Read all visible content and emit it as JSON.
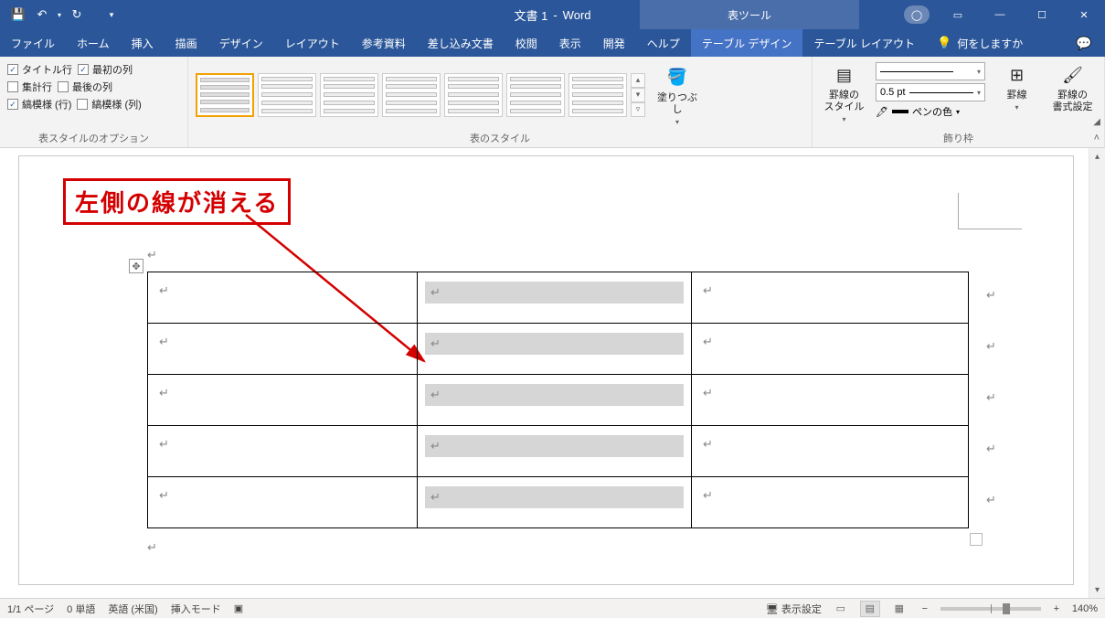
{
  "titlebar": {
    "doc_title": "文書 1",
    "app_name": "Word",
    "contextual_label": "表ツール"
  },
  "tabs": {
    "file": "ファイル",
    "home": "ホーム",
    "insert": "挿入",
    "draw": "描画",
    "design": "デザイン",
    "layout": "レイアウト",
    "references": "参考資料",
    "mailings": "差し込み文書",
    "review": "校閲",
    "view": "表示",
    "developer": "開発",
    "help": "ヘルプ",
    "table_design": "テーブル デザイン",
    "table_layout": "テーブル レイアウト",
    "tellme": "何をしますか"
  },
  "ribbon": {
    "group_style_options": "表スタイルのオプション",
    "group_table_styles": "表のスタイル",
    "group_borders": "飾り枠",
    "opt_header_row": "タイトル行",
    "opt_first_col": "最初の列",
    "opt_total_row": "集計行",
    "opt_last_col": "最後の列",
    "opt_banded_rows": "縞模様 (行)",
    "opt_banded_cols": "縞模様 (列)",
    "shading": "塗りつぶし",
    "border_styles": "罫線の\nスタイル",
    "border_weight": "0.5 pt",
    "pen_color": "ペンの色",
    "borders": "罫線",
    "border_painter": "罫線の\n書式設定"
  },
  "annotation": {
    "callout_text": "左側の線が消える"
  },
  "statusbar": {
    "page": "1/1 ページ",
    "words": "0 単語",
    "language": "英語 (米国)",
    "insert_mode": "挿入モード",
    "display_settings": "表示設定",
    "zoom": "140%"
  }
}
